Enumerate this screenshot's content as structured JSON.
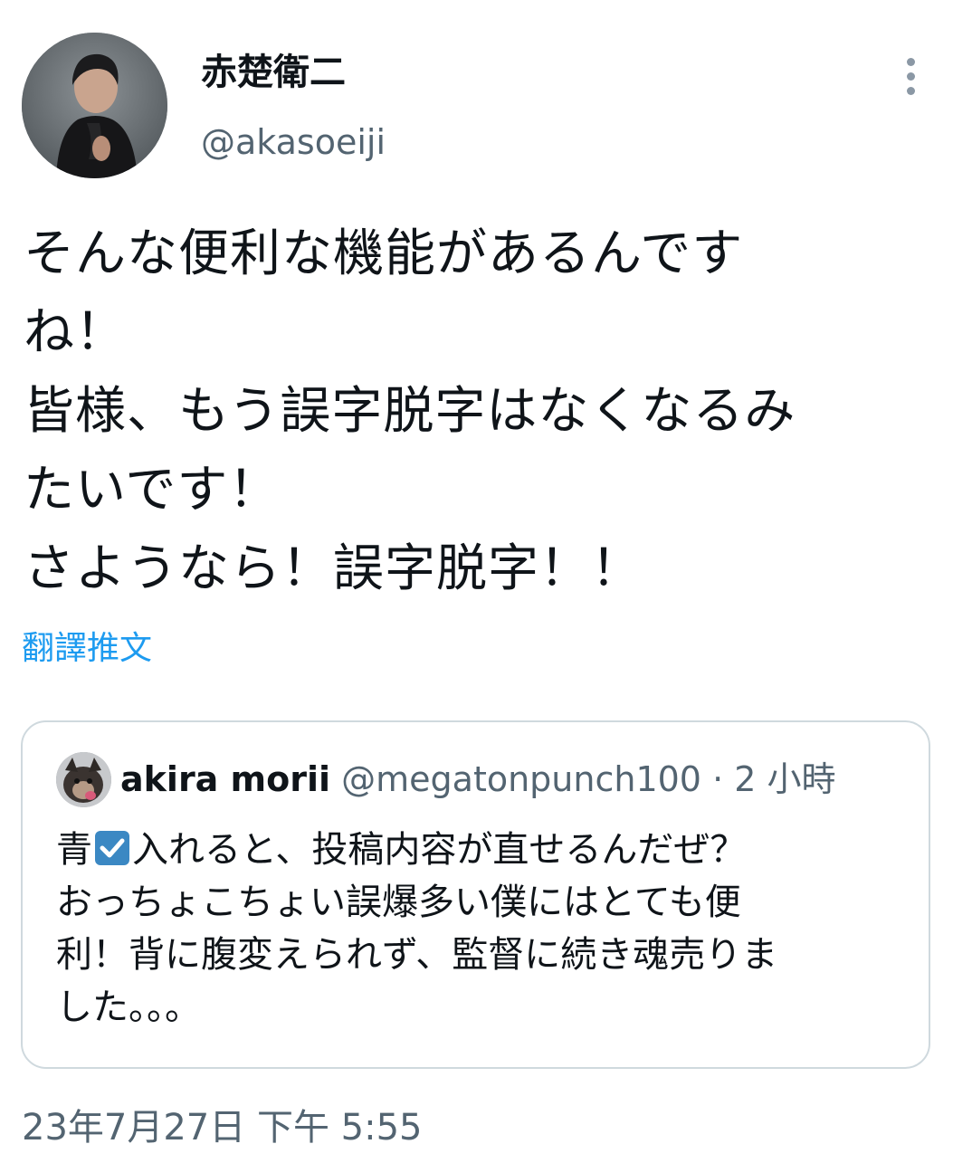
{
  "tweet": {
    "display_name": "赤楚衛二",
    "handle": "@akasoeiji",
    "text": "そんな便利な機能があるんです\nね！\n皆様、もう誤字脱字はなくなるみ\nたいです！\nさようなら！誤字脱字！！",
    "translate_label": "翻譯推文",
    "timestamp": "23年7月27日 下午 5:55"
  },
  "quote": {
    "display_name": "akira morii",
    "handle": "@megatonpunch100",
    "separator": " · ",
    "time": "2 小時",
    "text_before_emoji": "青",
    "emoji_icon": "check-mark-button-icon",
    "text_after_emoji": "入れると、投稿内容が直せるんだぜ？\nおっちょこちょい誤爆多い僕にはとても便\n利！背に腹変えられず、監督に続き魂売りま\nした。。。"
  },
  "colors": {
    "link": "#1d9bf0",
    "secondary_text": "#536471",
    "border": "#cfd9de",
    "emoji_blue": "#3b88c3"
  }
}
